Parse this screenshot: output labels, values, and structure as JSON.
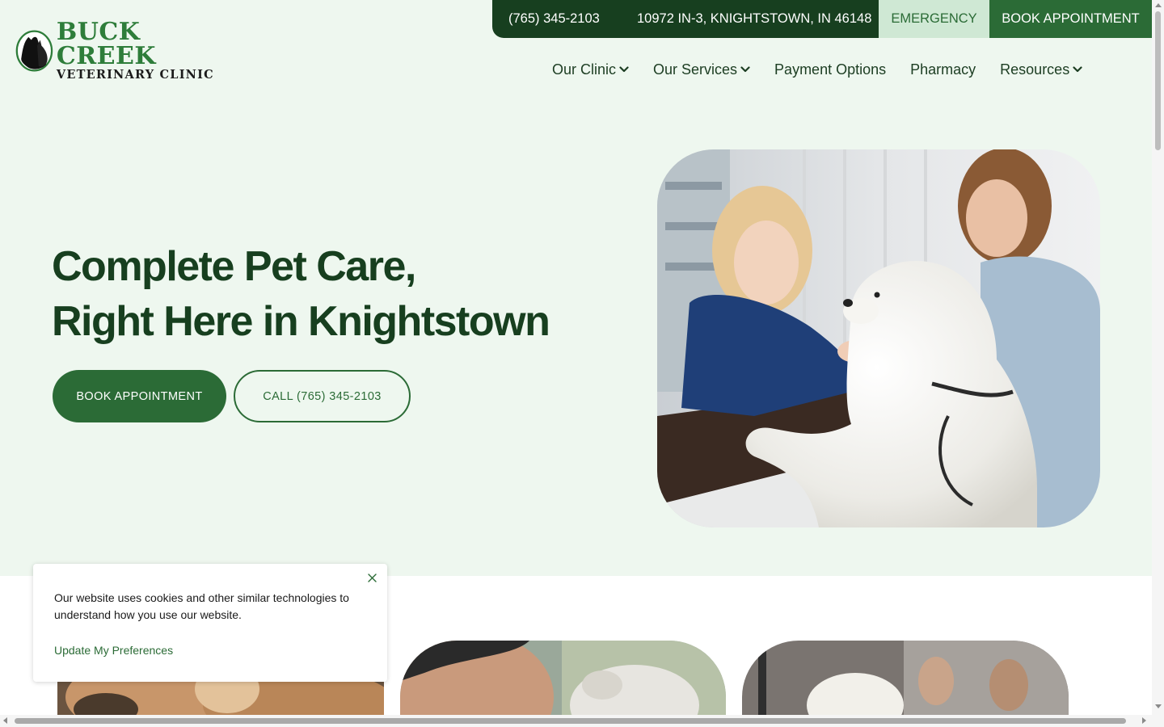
{
  "brand": {
    "name_line1": "BUCK CREEK",
    "name_line2": "VETERINARY CLINIC",
    "logo_icon": "dog-cat-silhouette-icon",
    "color": "#2e7d3a"
  },
  "topbar": {
    "phone": "(765) 345-2103",
    "address": "10972 IN-3, KNIGHTSTOWN, IN 46148",
    "emergency": "EMERGENCY",
    "book": "BOOK APPOINTMENT"
  },
  "nav": {
    "items": [
      {
        "label": "Our Clinic",
        "has_dropdown": true
      },
      {
        "label": "Our Services",
        "has_dropdown": true
      },
      {
        "label": "Payment Options",
        "has_dropdown": false
      },
      {
        "label": "Pharmacy",
        "has_dropdown": false
      },
      {
        "label": "Resources",
        "has_dropdown": true
      }
    ]
  },
  "hero": {
    "headline_line1": "Complete Pet Care,",
    "headline_line2": "Right Here in Knightstown",
    "primary_button": "BOOK APPOINTMENT",
    "secondary_button": "CALL (765) 345-2103"
  },
  "cookie": {
    "message": "Our website uses cookies and other similar technologies to understand how you use our website.",
    "link": "Update My Preferences",
    "close_icon": "close-icon"
  },
  "colors": {
    "dark_green": "#173f1f",
    "primary_green": "#2b6b36",
    "light_green": "#cfe8d4",
    "hero_bg": "#eef7ef"
  }
}
